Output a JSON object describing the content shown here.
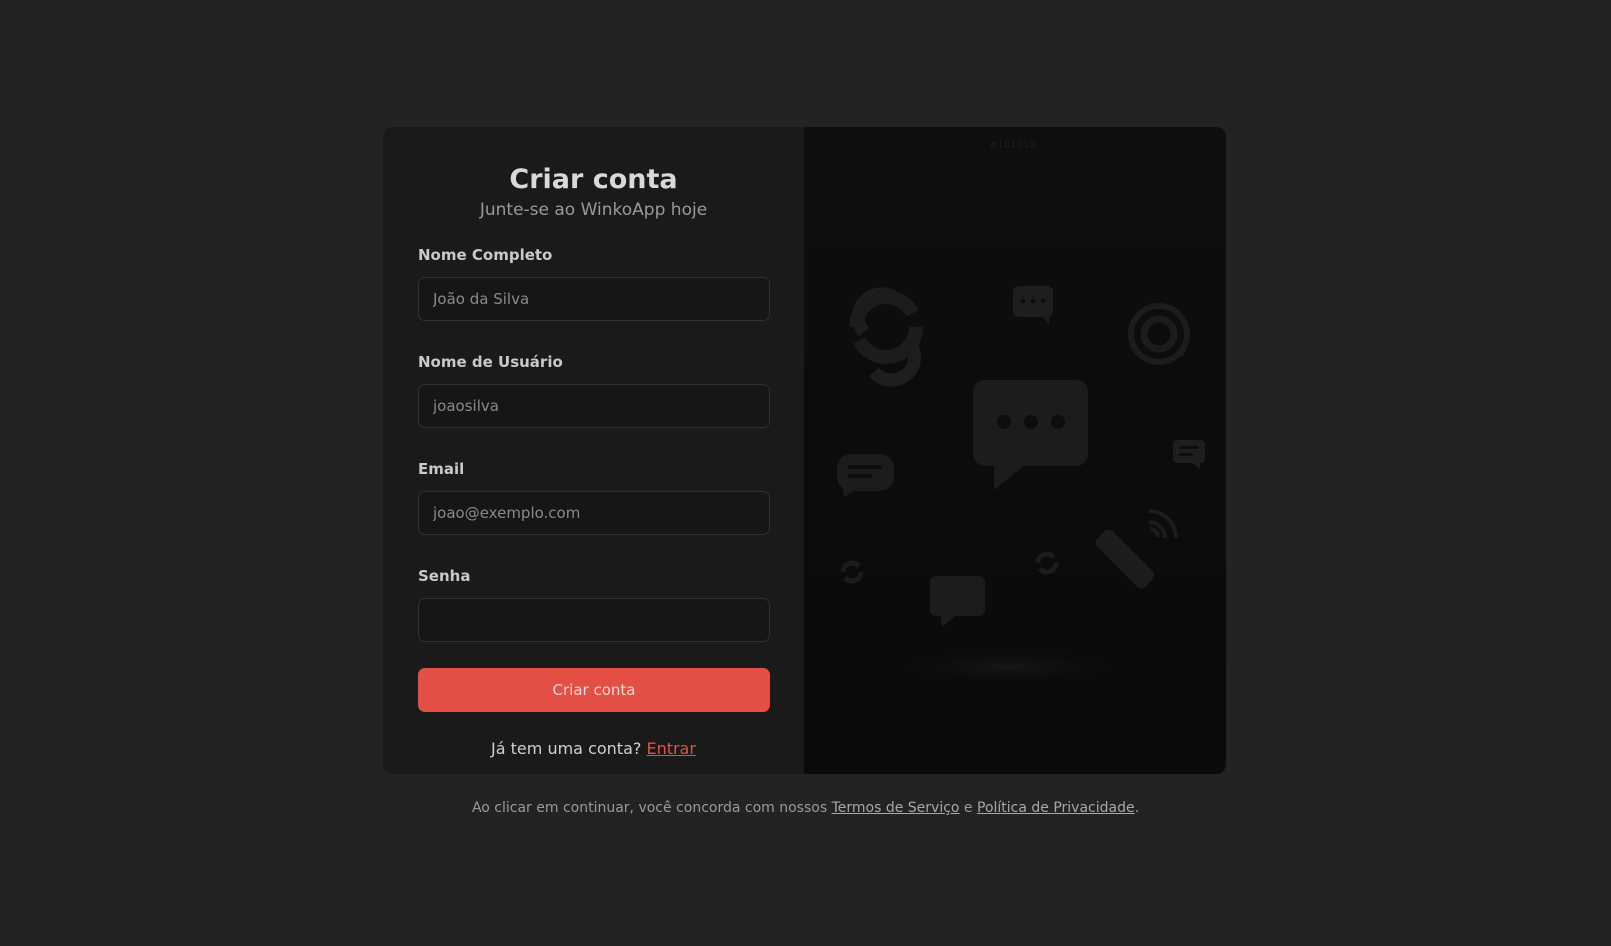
{
  "form": {
    "title": "Criar conta",
    "subtitle": "Junte-se ao WinkoApp hoje",
    "fields": [
      {
        "label": "Nome Completo",
        "placeholder": "João da Silva",
        "value": ""
      },
      {
        "label": "Nome de Usuário",
        "placeholder": "joaosilva",
        "value": ""
      },
      {
        "label": "Email",
        "placeholder": "joao@exemplo.com",
        "value": ""
      },
      {
        "label": "Senha",
        "placeholder": "",
        "value": ""
      }
    ],
    "submit_label": "Criar conta",
    "login_prompt": "Já tem uma conta?",
    "login_link": "Entrar"
  },
  "art": {
    "hex_label": "#101010",
    "icons": [
      "refresh-icon",
      "chat-bubble-icon",
      "sync-icon",
      "chat-bubble-large-icon",
      "message-icon",
      "message-small-icon",
      "refresh-small-icon",
      "chat-bubble-small-icon",
      "refresh-small-icon",
      "phone-icon"
    ]
  },
  "footer": {
    "prefix": "Ao clicar em continuar, você concorda com nossos",
    "terms_link": "Termos de Serviço",
    "conjunction": "e",
    "privacy_link": "Política de Privacidade",
    "suffix": "."
  },
  "colors": {
    "accent": "#e44f45",
    "background": "#232323",
    "card": "#1a1a1a"
  }
}
